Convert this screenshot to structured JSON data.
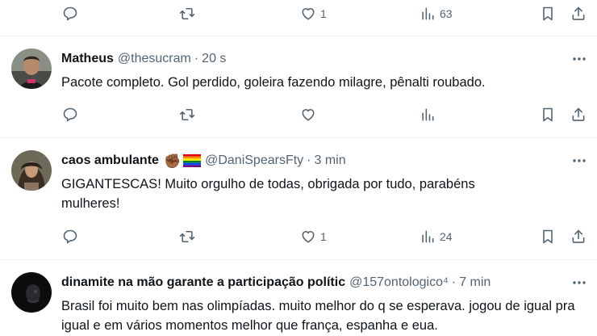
{
  "top_actions": {
    "reply_count": "",
    "retweet_count": "",
    "like_count": "1",
    "views_count": "63"
  },
  "tweets": [
    {
      "name": "Matheus",
      "handle": "@thesucram",
      "separator": "·",
      "time": "20 s",
      "text": "Pacote completo. Gol perdido, goleira fazendo milagre, pênalti roubado.",
      "actions": {
        "reply_count": "",
        "retweet_count": "",
        "like_count": "",
        "views_count": ""
      }
    },
    {
      "name": "caos ambulante",
      "badge_emoji": "✊🏾",
      "flag_icon": "rainbow-flag-icon",
      "handle": "@DaniSpearsFty",
      "separator": "·",
      "time": "3 min",
      "text": "GIGANTESCAS! Muito orgulho de todas, obrigada por tudo, parabéns mulheres!",
      "actions": {
        "reply_count": "",
        "retweet_count": "",
        "like_count": "1",
        "views_count": "24"
      }
    },
    {
      "name": "dinamite na mão garante a participação polític",
      "handle": "@157ontologico⁴",
      "separator": "·",
      "time": "7 min",
      "text": "Brasil foi muito bem nas olimpíadas. muito melhor do q se esperava. jogou de igual pra igual e em vários momentos melhor que frança, espanha e eua."
    }
  ],
  "colors": {
    "text": "#0f1419",
    "secondary": "#536471",
    "divider": "#eff3f4"
  }
}
